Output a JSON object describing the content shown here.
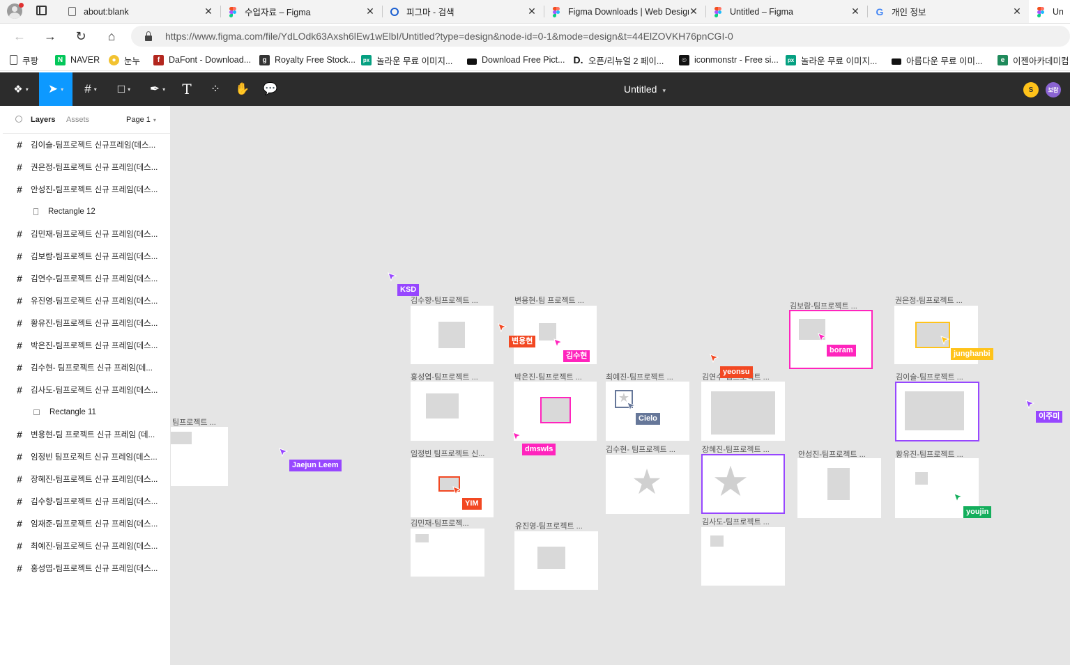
{
  "browser": {
    "tabs": [
      {
        "title": "about:blank",
        "icon": "document-icon"
      },
      {
        "title": "수업자료 – Figma",
        "icon": "figma-icon"
      },
      {
        "title": "피그마 - 검색",
        "icon": "search-icon"
      },
      {
        "title": "Figma Downloads | Web Design",
        "icon": "figma-icon"
      },
      {
        "title": "Untitled – Figma",
        "icon": "figma-icon"
      },
      {
        "title": "개인 정보",
        "icon": "google-icon"
      },
      {
        "title": "Unti",
        "icon": "figma-icon"
      }
    ],
    "url": "https://www.figma.com/file/YdLOdk63Axsh6lEw1wElbI/Untitled?type=design&node-id=0-1&mode=design&t=44ElZOVKH76pnCGI-0",
    "bookmarks": [
      {
        "label": "쿠팡",
        "icon": "document-icon",
        "color": "#ffffff"
      },
      {
        "label": "NAVER",
        "icon": "naver-icon",
        "color": "#03c75a"
      },
      {
        "label": "눈누",
        "icon": "noonnu-icon",
        "color": "#f2c230"
      },
      {
        "label": "DaFont - Download...",
        "icon": "dafont-icon",
        "color": "#b3261e"
      },
      {
        "label": "Royalty Free Stock...",
        "icon": "stock-icon",
        "color": "#333333"
      },
      {
        "label": "놀라운 무료 이미지...",
        "icon": "pexels-icon",
        "color": "#05a081"
      },
      {
        "label": "Download Free Pict...",
        "icon": "unsplash-icon",
        "color": "#111111"
      },
      {
        "label": "오픈/리뉴얼 2 페이...",
        "icon": "d-icon",
        "color": "#111111"
      },
      {
        "label": "iconmonstr - Free si...",
        "icon": "iconmonstr-icon",
        "color": "#111111"
      },
      {
        "label": "놀라운 무료 이미지...",
        "icon": "pexels-icon",
        "color": "#05a081"
      },
      {
        "label": "아름다운 무료 이미...",
        "icon": "unsplash-icon",
        "color": "#111111"
      },
      {
        "label": "이젠아카데미컴",
        "icon": "ezen-icon",
        "color": "#1f8a5b"
      }
    ]
  },
  "figma": {
    "file_title": "Untitled",
    "avatars": [
      {
        "initial": "S",
        "color": "#ffc31a"
      },
      {
        "initial": "보람",
        "color": "#8a63d2"
      }
    ],
    "panel": {
      "tab_layers": "Layers",
      "tab_assets": "Assets",
      "page": "Page 1"
    },
    "layers": [
      {
        "name": "김이슬-팀프로젝트 신규프레임(데스...",
        "type": "frame"
      },
      {
        "name": "권은정-팀프로젝트 신규 프레임(데스...",
        "type": "frame"
      },
      {
        "name": "안성진-팀프로젝트 신규 프레임(데스...",
        "type": "frame"
      },
      {
        "name": "Rectangle 12",
        "type": "rect"
      },
      {
        "name": "김민재-팀프로젝트 신규 프레임(데스...",
        "type": "frame"
      },
      {
        "name": "김보람-팀프로젝트 신규 프레임(데스...",
        "type": "frame"
      },
      {
        "name": "김연수-팀프로젝트 신규 프레임(데스...",
        "type": "frame"
      },
      {
        "name": "유진영-팀프로젝트 신규 프레임(데스...",
        "type": "frame"
      },
      {
        "name": "황유진-팀프로젝트 신규 프레임(데스...",
        "type": "frame"
      },
      {
        "name": "박은진-팀프로젝트 신규 프레임(데스...",
        "type": "frame"
      },
      {
        "name": "김수현- 팀프로젝트 신규 프레임(데...",
        "type": "frame"
      },
      {
        "name": "김사도-팀프로젝트 신규 프레임(데스...",
        "type": "frame"
      },
      {
        "name": "Rectangle 11",
        "type": "rect"
      },
      {
        "name": "변용현-팀 프로젝트 신규 프레임 (데...",
        "type": "frame"
      },
      {
        "name": "임정빈 팀프로젝트 신규 프레임(데스...",
        "type": "frame"
      },
      {
        "name": "장혜진-팀프로젝트 신규 프레임(데스...",
        "type": "frame"
      },
      {
        "name": "김수향-팀프로젝트 신규 프레임(데스...",
        "type": "frame"
      },
      {
        "name": "임재준-팀프로젝트 신규 프레임(데스...",
        "type": "frame"
      },
      {
        "name": "최예진-팀프로젝트 신규 프레임(데스...",
        "type": "frame"
      },
      {
        "name": "홍성엽-팀프로젝트 신규 프레임(데스...",
        "type": "frame"
      }
    ],
    "frames": [
      {
        "label": "팀프로젝트 ..."
      },
      {
        "label": "김수향-팀프로젝트 ..."
      },
      {
        "label": "변용현-팀 프로젝트 ..."
      },
      {
        "label": "김보람-팀프로젝트 ..."
      },
      {
        "label": "권은정-팀프로젝트 ..."
      },
      {
        "label": "홍성엽-팀프로젝트 ..."
      },
      {
        "label": "박은진-팀프로젝트 ..."
      },
      {
        "label": "최예진-팀프로젝트 ..."
      },
      {
        "label": "김연수-팀프로젝트 ..."
      },
      {
        "label": "김이슬-팀프로젝트 ..."
      },
      {
        "label": "임정빈 팀프로젝트 신..."
      },
      {
        "label": "김수현- 팀프로젝트 ..."
      },
      {
        "label": "장혜진-팀프로젝트 ..."
      },
      {
        "label": "안성진-팀프로젝트 ..."
      },
      {
        "label": "황유진-팀프로젝트 ..."
      },
      {
        "label": "김민재-팀프로젝..."
      },
      {
        "label": "유진영-팀프로젝트 ..."
      },
      {
        "label": "김사도-팀프로젝트 ..."
      }
    ],
    "cursors": [
      {
        "name": "KSD",
        "color": "#9747ff"
      },
      {
        "name": "변용현",
        "color": "#f24822"
      },
      {
        "name": "김수현",
        "color": "#ff24bd"
      },
      {
        "name": "boram",
        "color": "#ff24bd"
      },
      {
        "name": "junghanbi",
        "color": "#ffc31a"
      },
      {
        "name": "yeonsu",
        "color": "#f24822"
      },
      {
        "name": "Cielo",
        "color": "#667799"
      },
      {
        "name": "dmswls",
        "color": "#ff24bd"
      },
      {
        "name": "이주미",
        "color": "#9747ff"
      },
      {
        "name": "Jaejun Leem",
        "color": "#9747ff"
      },
      {
        "name": "YIM",
        "color": "#f24822"
      },
      {
        "name": "youjin",
        "color": "#14ae5c"
      }
    ]
  }
}
